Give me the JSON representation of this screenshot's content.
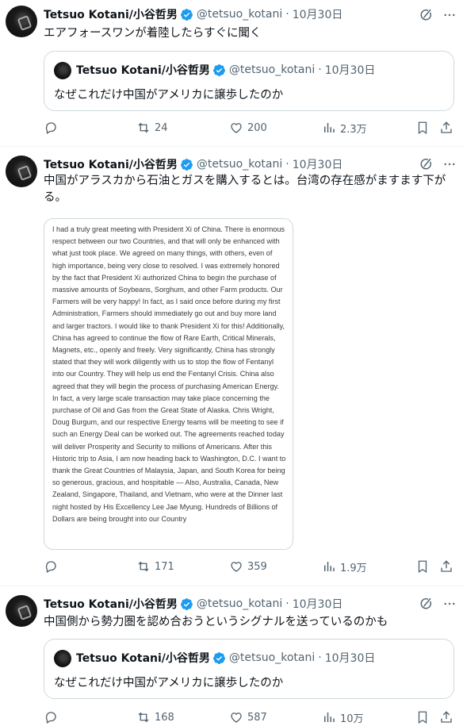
{
  "tweets": [
    {
      "author": {
        "name": "Tetsuo Kotani/小谷哲男",
        "handle": "@tetsuo_kotani",
        "date": "10月30日"
      },
      "text": "エアフォースワンが着陸したらすぐに聞く",
      "quote": {
        "author": {
          "name": "Tetsuo Kotani/小谷哲男",
          "handle": "@tetsuo_kotani",
          "date": "10月30日"
        },
        "text": "なぜこれだけ中国がアメリカに譲歩したのか"
      },
      "stats": {
        "replies": "",
        "retweets": "24",
        "likes": "200",
        "views": "2.3万"
      }
    },
    {
      "author": {
        "name": "Tetsuo Kotani/小谷哲男",
        "handle": "@tetsuo_kotani",
        "date": "10月30日"
      },
      "text": "中国がアラスカから石油とガスを購入するとは。台湾の存在感がますます下がる。",
      "media_text": "I had a truly great meeting with President Xi of China. There is enormous respect between our two Countries, and that will only be enhanced with what just took place. We agreed on many things, with others, even of high importance, being very close to resolved. I was extremely honored by the fact that President Xi authorized China to begin the purchase of massive amounts of Soybeans, Sorghum, and other Farm products. Our Farmers will be very happy! In fact, as I said once before during my first Administration, Farmers should immediately go out and buy more land and larger tractors. I would like to thank President Xi for this! Additionally, China has agreed to continue the flow of Rare Earth, Critical Minerals, Magnets, etc., openly and freely. Very significantly, China has strongly stated that they will work diligently with us to stop the flow of Fentanyl into our Country. They will help us end the Fentanyl Crisis. China also agreed that they will begin the process of purchasing American Energy. In fact, a very large scale transaction may take place concerning the purchase of Oil and Gas from the Great State of Alaska. Chris Wright, Doug Burgum, and our respective Energy teams will be meeting to see if such an Energy Deal can be worked out. The agreements reached today will deliver Prosperity and Security to millions of Americans. After this Historic trip to Asia, I am now heading back to Washington, D.C. I want to thank the Great Countries of Malaysia, Japan, and South Korea for being so generous, gracious, and hospitable — Also, Australia, Canada, New Zealand, Singapore, Thailand, and Vietnam, who were at the Dinner last night hosted by His Excellency Lee Jae Myung. Hundreds of Billions of Dollars are being brought into our Country",
      "stats": {
        "replies": "",
        "retweets": "171",
        "likes": "359",
        "views": "1.9万"
      }
    },
    {
      "author": {
        "name": "Tetsuo Kotani/小谷哲男",
        "handle": "@tetsuo_kotani",
        "date": "10月30日"
      },
      "text": "中国側から勢力圏を認め合おうというシグナルを送っているのかも",
      "quote": {
        "author": {
          "name": "Tetsuo Kotani/小谷哲男",
          "handle": "@tetsuo_kotani",
          "date": "10月30日"
        },
        "text": "なぜこれだけ中国がアメリカに譲歩したのか"
      },
      "stats": {
        "replies": "",
        "retweets": "168",
        "likes": "587",
        "views": "10万"
      }
    }
  ],
  "colors": {
    "text": "#0f1419",
    "secondary": "#536471",
    "verified": "#1d9bf0",
    "border": "#cfd9de"
  }
}
